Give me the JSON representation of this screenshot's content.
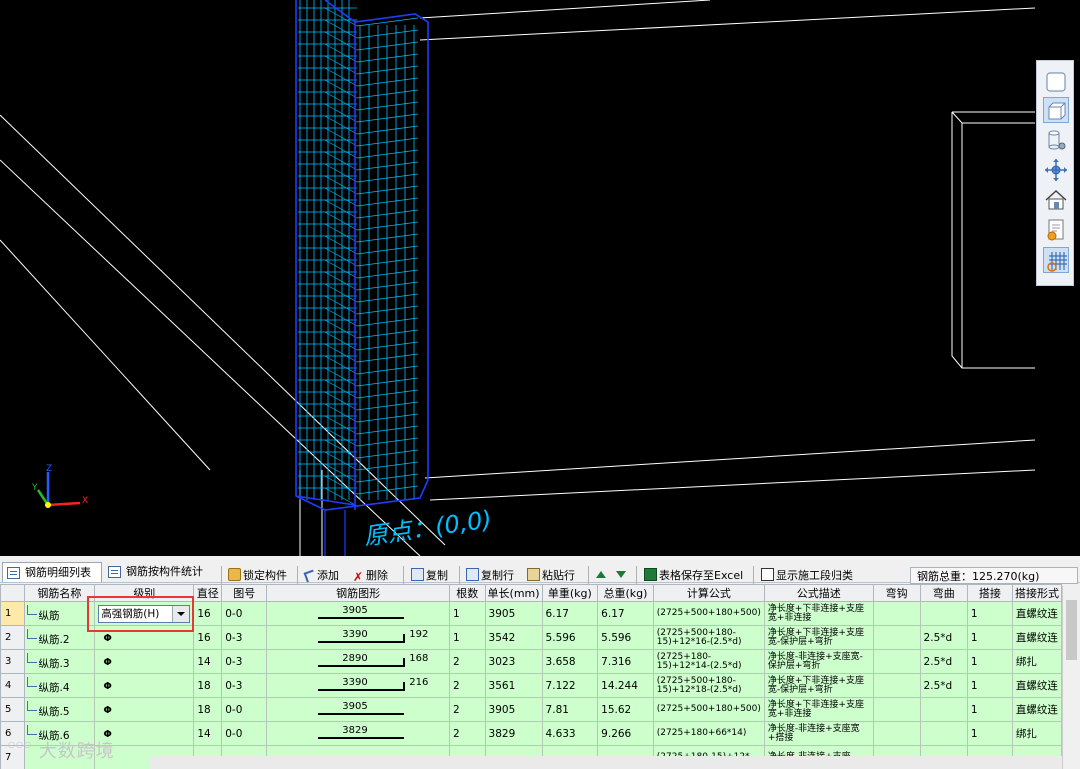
{
  "viewport": {
    "origin_label": "原点：(0,0)",
    "axes": {
      "x": "X",
      "y": "Y",
      "z": "Z"
    },
    "colors": {
      "background": "#000000",
      "rebar": "#00bfff",
      "outline": "#1f3dff",
      "edge": "#ffffff"
    }
  },
  "view_toolbar": {
    "icons": [
      "box-outline-icon",
      "box-3d-icon",
      "cylinder-icon",
      "orbit-icon",
      "house-icon",
      "report-icon",
      "rebar-view-icon"
    ]
  },
  "tabs": [
    {
      "label": "钢筋明细列表",
      "icon": "table-icon"
    },
    {
      "label": "钢筋按构件统计",
      "icon": "table-icon"
    }
  ],
  "toolbar": {
    "lock": "锁定构件",
    "add": "添加",
    "delete": "删除",
    "copy": "复制",
    "copy_row": "复制行",
    "paste_row": "粘贴行",
    "save_excel": "表格保存至Excel",
    "show_stage": "显示施工段归类",
    "total": "钢筋总重：125.270(kg)"
  },
  "grid": {
    "headers": [
      "钢筋名称",
      "级别",
      "直径",
      "图号",
      "钢筋图形",
      "根数",
      "单长(mm)",
      "单重(kg)",
      "总重(kg)",
      "计算公式",
      "公式描述",
      "弯钩",
      "弯曲",
      "搭接",
      "搭接形式"
    ],
    "rows": [
      {
        "no": "1",
        "name": "纵筋",
        "grade": "高强钢筋(H)",
        "dia": "16",
        "fig": "0-0",
        "shape_main": "3905",
        "shape_hook": "",
        "count": "1",
        "len": "3905",
        "unit_w": "6.17",
        "total_w": "6.17",
        "formula": "(2725+500+180+500)",
        "desc": "净长度+下非连接+支座宽+非连接",
        "hook": "",
        "bend": "",
        "lap": "1",
        "lap_type": "直螺纹连"
      },
      {
        "no": "2",
        "name": "纵筋.2",
        "grade": "Φ",
        "dia": "16",
        "fig": "0-3",
        "shape_main": "3390",
        "shape_hook": "192",
        "count": "1",
        "len": "3542",
        "unit_w": "5.596",
        "total_w": "5.596",
        "formula": "(2725+500+180-15)+12*16-(2.5*d)",
        "desc": "净长度+下非连接+支座宽-保护层+弯折",
        "hook": "",
        "bend": "2.5*d",
        "lap": "1",
        "lap_type": "直螺纹连"
      },
      {
        "no": "3",
        "name": "纵筋.3",
        "grade": "Φ",
        "dia": "14",
        "fig": "0-3",
        "shape_main": "2890",
        "shape_hook": "168",
        "count": "2",
        "len": "3023",
        "unit_w": "3.658",
        "total_w": "7.316",
        "formula": "(2725+180-15)+12*14-(2.5*d)",
        "desc": "净长度-非连接+支座宽-保护层+弯折",
        "hook": "",
        "bend": "2.5*d",
        "lap": "1",
        "lap_type": "绑扎"
      },
      {
        "no": "4",
        "name": "纵筋.4",
        "grade": "Φ",
        "dia": "18",
        "fig": "0-3",
        "shape_main": "3390",
        "shape_hook": "216",
        "count": "2",
        "len": "3561",
        "unit_w": "7.122",
        "total_w": "14.244",
        "formula": "(2725+500+180-15)+12*18-(2.5*d)",
        "desc": "净长度+下非连接+支座宽-保护层+弯折",
        "hook": "",
        "bend": "2.5*d",
        "lap": "1",
        "lap_type": "直螺纹连"
      },
      {
        "no": "5",
        "name": "纵筋.5",
        "grade": "Φ",
        "dia": "18",
        "fig": "0-0",
        "shape_main": "3905",
        "shape_hook": "",
        "count": "2",
        "len": "3905",
        "unit_w": "7.81",
        "total_w": "15.62",
        "formula": "(2725+500+180+500)",
        "desc": "净长度+下非连接+支座宽+非连接",
        "hook": "",
        "bend": "",
        "lap": "1",
        "lap_type": "直螺纹连"
      },
      {
        "no": "6",
        "name": "纵筋.6",
        "grade": "Φ",
        "dia": "14",
        "fig": "0-0",
        "shape_main": "3829",
        "shape_hook": "",
        "count": "2",
        "len": "3829",
        "unit_w": "4.633",
        "total_w": "9.266",
        "formula": "(2725+180+66*14)",
        "desc": "净长度-非连接+支座宽+搭接",
        "hook": "",
        "bend": "",
        "lap": "1",
        "lap_type": "绑扎"
      },
      {
        "no": "7",
        "name": "",
        "grade": "",
        "dia": "",
        "fig": "",
        "shape_main": "",
        "shape_hook": "",
        "count": "",
        "len": "",
        "unit_w": "",
        "total_w": "",
        "formula": "(2725+180-15)+12*",
        "desc": "净长度-非连接+支座",
        "hook": "",
        "bend": "",
        "lap": "",
        "lap_type": ""
      }
    ]
  },
  "watermark": "大数跨境"
}
